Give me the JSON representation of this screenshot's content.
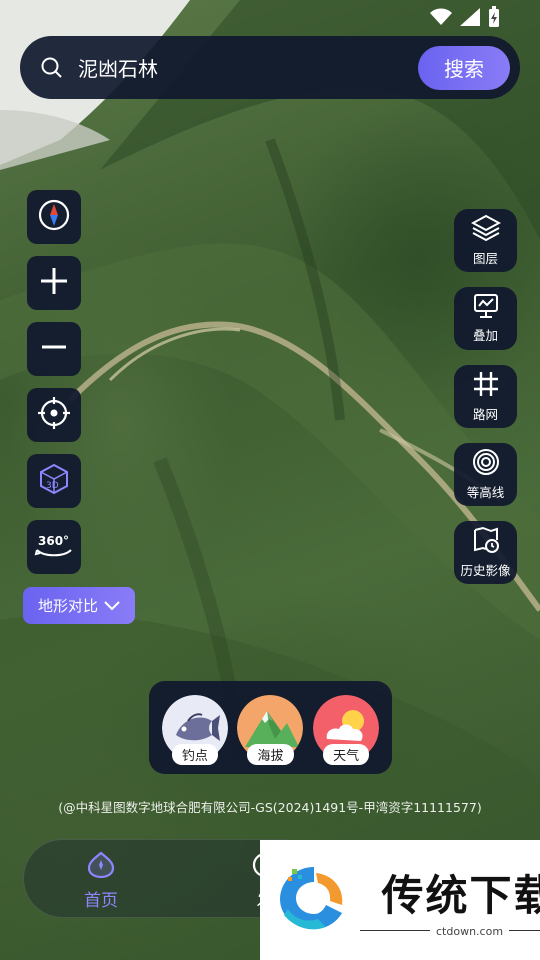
{
  "search": {
    "query": "泥凼石林",
    "button_label": "搜索"
  },
  "left_tools": {
    "compass": "compass-icon",
    "zoom_in": "plus-icon",
    "zoom_out": "minus-icon",
    "locate": "crosshair-icon",
    "three_d": "3D",
    "panorama": "360°",
    "terrain_compare_label": "地形对比"
  },
  "right_tools": [
    {
      "label": "图层",
      "icon": "layers-icon"
    },
    {
      "label": "叠加",
      "icon": "overlay-chart-icon"
    },
    {
      "label": "路网",
      "icon": "road-grid-icon"
    },
    {
      "label": "等高线",
      "icon": "contour-icon"
    },
    {
      "label": "历史影像",
      "icon": "history-image-icon"
    }
  ],
  "dock": [
    {
      "label": "钓点",
      "icon": "fish-icon"
    },
    {
      "label": "海拔",
      "icon": "mountain-icon"
    },
    {
      "label": "天气",
      "icon": "weather-icon"
    }
  ],
  "attribution": "(@中科星图数字地球合肥有限公司-GS(2024)1491号-甲湾资字11111577)",
  "bottom_nav": {
    "home_label": "首页",
    "second_label": "发"
  },
  "watermark": {
    "title": "传统下载",
    "url": "ctdown.com"
  },
  "colors": {
    "panel": "#10182e",
    "accent": "#6a63f0",
    "active_tab": "#8f86ff"
  }
}
